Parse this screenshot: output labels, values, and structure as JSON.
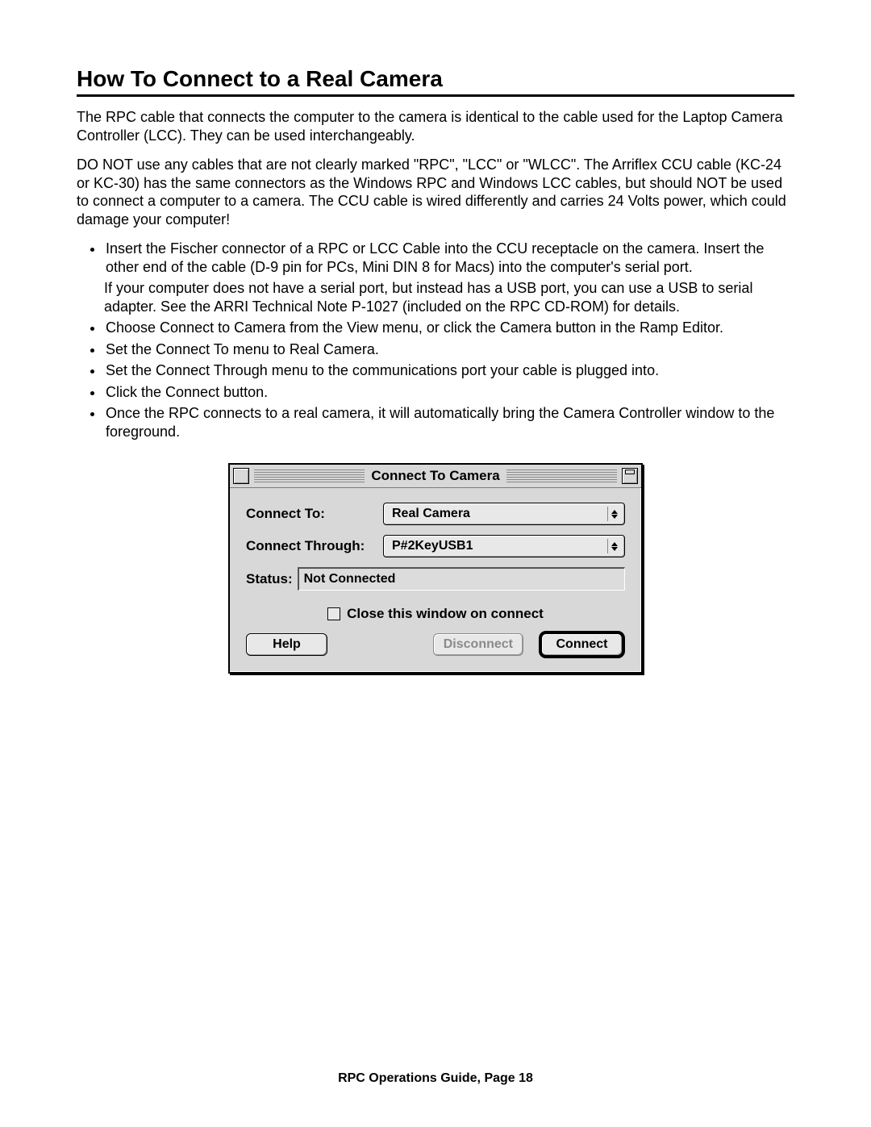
{
  "heading": "How To Connect to a Real Camera",
  "para1": "The RPC cable that connects the computer to the camera is identical to the cable used for the Laptop Camera Controller (LCC). They can be used interchangeably.",
  "para2": "DO NOT use any cables that are not clearly marked \"RPC\", \"LCC\" or \"WLCC\". The Arriflex CCU cable (KC-24 or KC-30) has the same connectors as the Windows RPC and Windows LCC cables, but should NOT be used to connect a computer to a camera. The CCU cable is wired differently and carries 24 Volts power, which could damage your computer!",
  "bullets": [
    "Insert the Fischer connector of a RPC or LCC Cable into the CCU receptacle on the camera. Insert the other end of the cable (D-9 pin for PCs, Mini DIN 8 for Macs) into the computer's serial port.",
    "If your computer does not have a serial port, but instead has a USB port, you can use a USB to serial adapter. See the ARRI Technical Note P-1027 (included on the RPC CD-ROM) for details.",
    "Choose Connect to Camera from the View menu, or click the Camera button in the Ramp Editor.",
    "Set the Connect To menu to Real Camera.",
    "Set the Connect Through menu to the communications port your cable is plugged into.",
    "Click the Connect button.",
    "Once the RPC connects to a real camera, it will automatically bring the Camera Controller window to the foreground."
  ],
  "dialog": {
    "title": "Connect To Camera",
    "connect_to_label": "Connect To:",
    "connect_to_value": "Real Camera",
    "connect_through_label": "Connect Through:",
    "connect_through_value": "P#2KeyUSB1",
    "status_label": "Status:",
    "status_value": "Not Connected",
    "checkbox_label": "Close this window on connect",
    "help": "Help",
    "disconnect": "Disconnect",
    "connect": "Connect"
  },
  "footer": "RPC Operations Guide, Page 18"
}
